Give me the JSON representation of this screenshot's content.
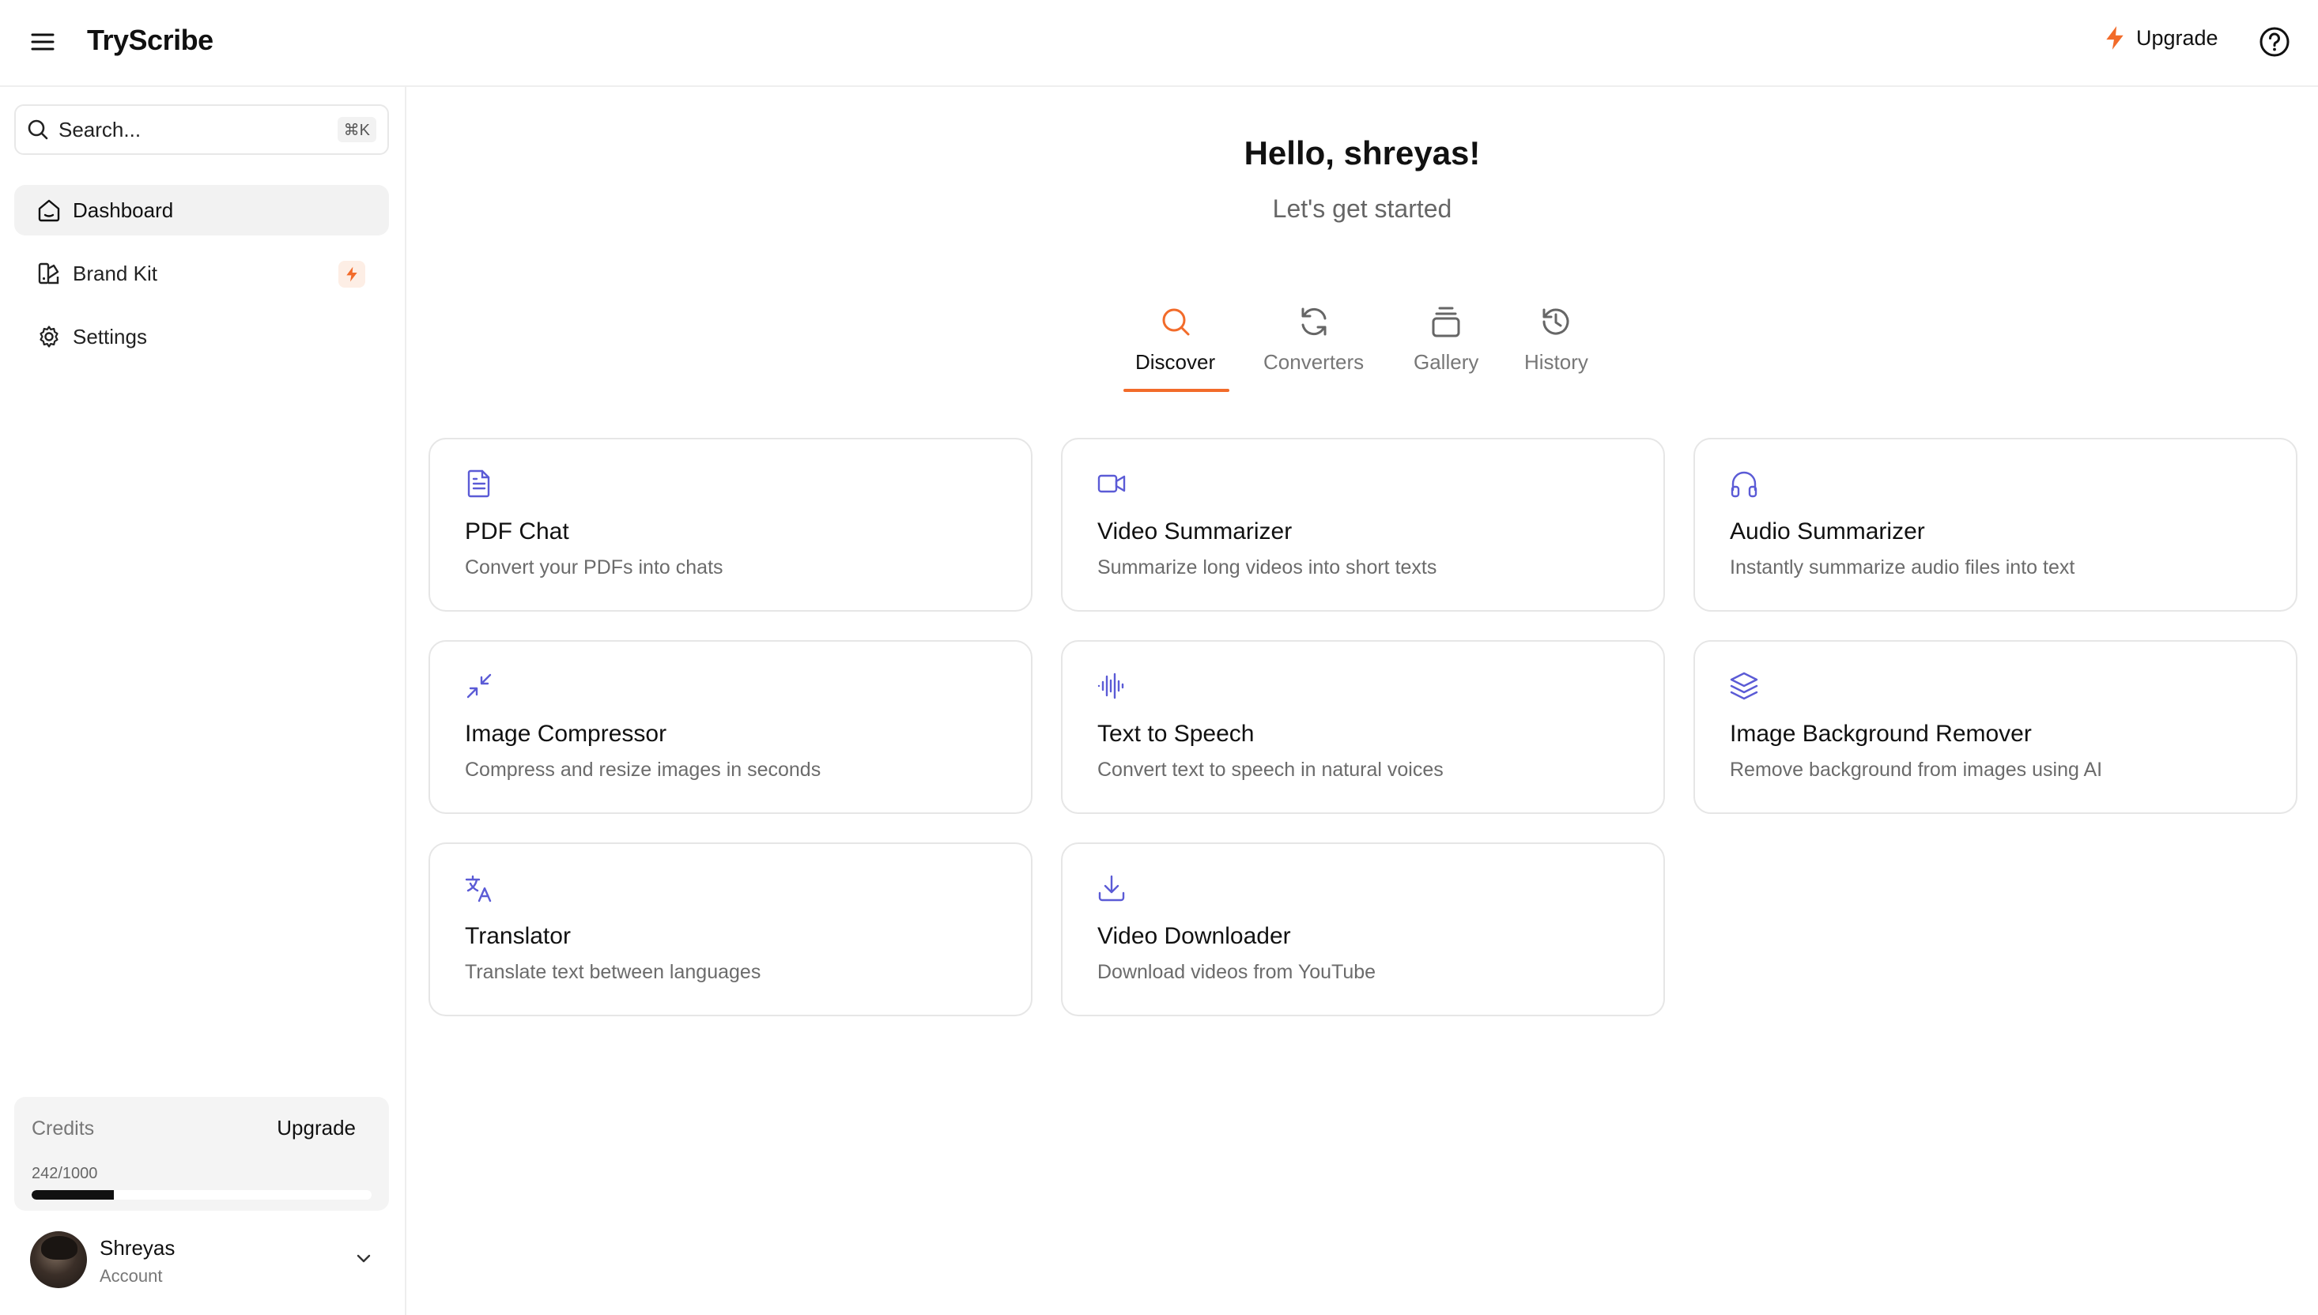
{
  "header": {
    "brand": "TryScribe",
    "upgrade_label": "Upgrade",
    "accent_color": "#f26b2a"
  },
  "sidebar": {
    "search": {
      "placeholder": "Search...",
      "shortcut": "⌘K"
    },
    "items": [
      {
        "label": "Dashboard",
        "icon": "home-icon",
        "active": true
      },
      {
        "label": "Brand Kit",
        "icon": "palette-icon",
        "badge": "bolt-icon"
      },
      {
        "label": "Settings",
        "icon": "gear-icon"
      }
    ],
    "credits": {
      "label": "Credits",
      "upgrade_label": "Upgrade",
      "count": "242/1000",
      "used": 242,
      "total": 1000
    },
    "account": {
      "name": "Shreyas",
      "subtitle": "Account"
    }
  },
  "main": {
    "greeting": "Hello, shreyas!",
    "subtitle": "Let's get started",
    "tabs": [
      {
        "label": "Discover",
        "icon": "search-icon",
        "active": true
      },
      {
        "label": "Converters",
        "icon": "refresh-icon"
      },
      {
        "label": "Gallery",
        "icon": "gallery-icon"
      },
      {
        "label": "History",
        "icon": "history-icon"
      }
    ],
    "cards": [
      {
        "title": "PDF Chat",
        "desc": "Convert your PDFs into chats",
        "icon": "file-text-icon"
      },
      {
        "title": "Video Summarizer",
        "desc": "Summarize long videos into short texts",
        "icon": "video-icon"
      },
      {
        "title": "Audio Summarizer",
        "desc": "Instantly summarize audio files into text",
        "icon": "headphones-icon"
      },
      {
        "title": "Image Compressor",
        "desc": "Compress and resize images in seconds",
        "icon": "minimize-icon"
      },
      {
        "title": "Text to Speech",
        "desc": "Convert text to speech in natural voices",
        "icon": "audio-waveform-icon"
      },
      {
        "title": "Image Background Remover",
        "desc": "Remove background from images using AI",
        "icon": "layers-icon"
      },
      {
        "title": "Translator",
        "desc": "Translate text between languages",
        "icon": "translate-icon"
      },
      {
        "title": "Video Downloader",
        "desc": "Download videos from YouTube",
        "icon": "download-icon"
      }
    ],
    "card_icon_color": "#5b5bd6"
  }
}
